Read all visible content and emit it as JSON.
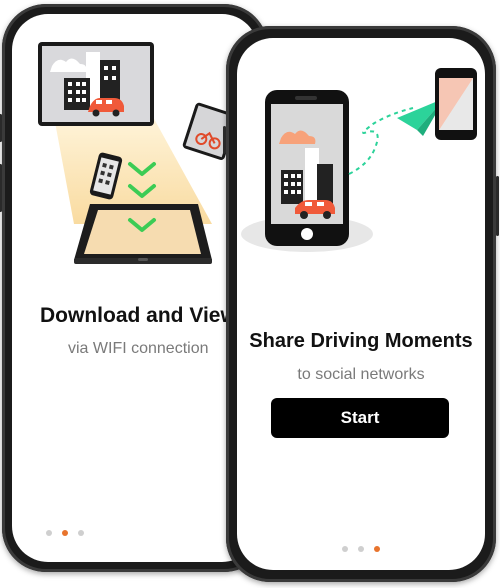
{
  "onboarding_back": {
    "title": "Download and View",
    "subtitle": "via WIFI connection",
    "page_indicator": {
      "count": 3,
      "active_index": 1
    }
  },
  "onboarding_front": {
    "title": "Share Driving Moments",
    "subtitle": "to social networks",
    "start_label": "Start",
    "page_indicator": {
      "count": 3,
      "active_index": 2
    }
  },
  "colors": {
    "accent": "#e8742d",
    "car": "#f05a3a",
    "arrow_green": "#2cd39a",
    "chevron_green": "#3ccc55",
    "button_bg": "#000000"
  },
  "icons": [
    "city-car-illustration",
    "tablet-icon",
    "download-chevrons-icon",
    "paper-plane-icon",
    "smartphone-icon"
  ]
}
